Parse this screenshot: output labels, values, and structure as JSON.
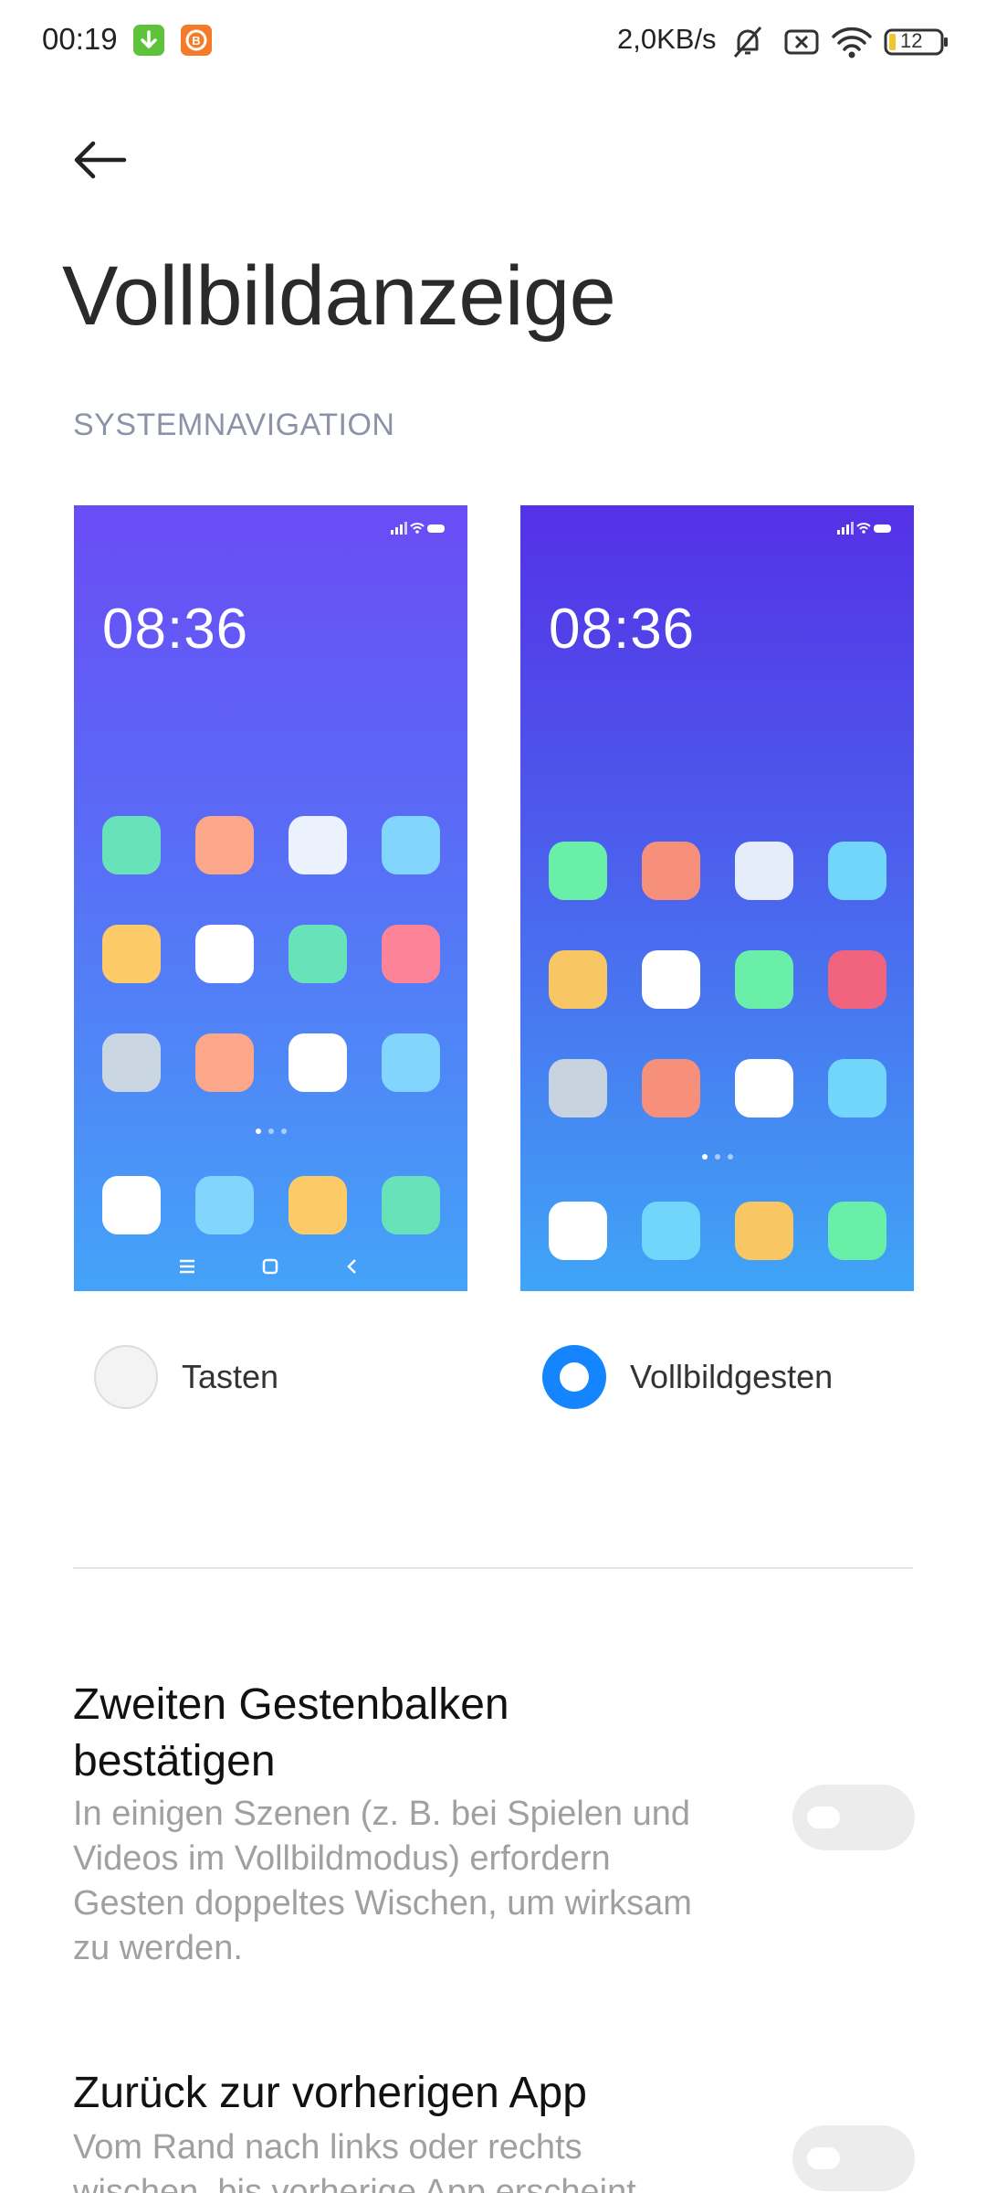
{
  "status_bar": {
    "time": "00:19",
    "net_speed": "2,0KB/s",
    "battery": "12",
    "icons": [
      "download-app-icon",
      "bitcoin-app-icon",
      "bell-muted-icon",
      "sim-none-icon",
      "wifi-icon",
      "battery-icon"
    ],
    "app_colors": [
      "#5cc33b",
      "#f57b2a"
    ]
  },
  "header": {
    "back_icon": "arrow-left-icon",
    "title": "Vollbildanzeige"
  },
  "section": {
    "label": "SYSTEMNAVIGATION"
  },
  "previews": [
    {
      "clock": "08:36",
      "apps": [
        "#68e2b8",
        "#fca789",
        "#ebf2fd",
        "#82d5fd",
        "#fdca68",
        "#ffffff",
        "#68e2b8",
        "#fd8398",
        "#cad6e2",
        "#fca789",
        "#ffffff",
        "#82d5fd"
      ],
      "dock": [
        "#ffffff",
        "#82d5fd",
        "#fdca68",
        "#68e2b8"
      ],
      "nav_icons": [
        "menu-icon",
        "home-square-icon",
        "back-chevron-icon"
      ]
    },
    {
      "clock": "08:36",
      "apps": [
        "#6aefa8",
        "#f6907a",
        "#e5edfb",
        "#72d6fb",
        "#f8c662",
        "#ffffff",
        "#6aefa8",
        "#f2637e",
        "#c7d3df",
        "#f6907a",
        "#ffffff",
        "#72d6fb"
      ],
      "dock": [
        "#ffffff",
        "#72d6fb",
        "#f8c662",
        "#6aefa8"
      ]
    }
  ],
  "options": {
    "buttons_label": "Tasten",
    "gestures_label": "Vollbildgesten",
    "selected": "Vollbildgesten",
    "accent_color": "#1584ff"
  },
  "settings": [
    {
      "title_line1": "Zweiten Gestenbalken",
      "title_line2": "bestätigen",
      "desc_line1": "In einigen Szenen (z. B. bei Spielen und",
      "desc_line2": "Videos im Vollbildmodus) erfordern",
      "desc_line3": "Gesten doppeltes Wischen, um wirksam",
      "desc_line4": "zu werden.",
      "enabled": false
    },
    {
      "title_line1": "Zurück zur vorherigen App",
      "desc_line1": "Vom Rand nach links oder rechts",
      "desc_line2": "wischen, bis vorherige App erscheint",
      "enabled": false
    }
  ]
}
